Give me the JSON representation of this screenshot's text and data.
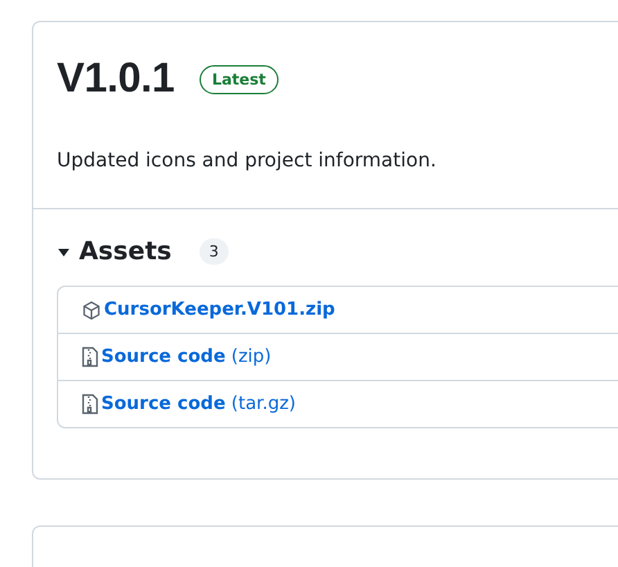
{
  "release": {
    "title": "V1.0.1",
    "badge": "Latest",
    "description": "Updated icons and project information."
  },
  "assets": {
    "label": "Assets",
    "count": "3",
    "expanded": true,
    "items": [
      {
        "kind": "package",
        "name": "CursorKeeper.V101.zip"
      },
      {
        "kind": "archive",
        "name": "Source code",
        "suffix": "(zip)"
      },
      {
        "kind": "archive",
        "name": "Source code",
        "suffix": "(tar.gz)"
      }
    ]
  }
}
